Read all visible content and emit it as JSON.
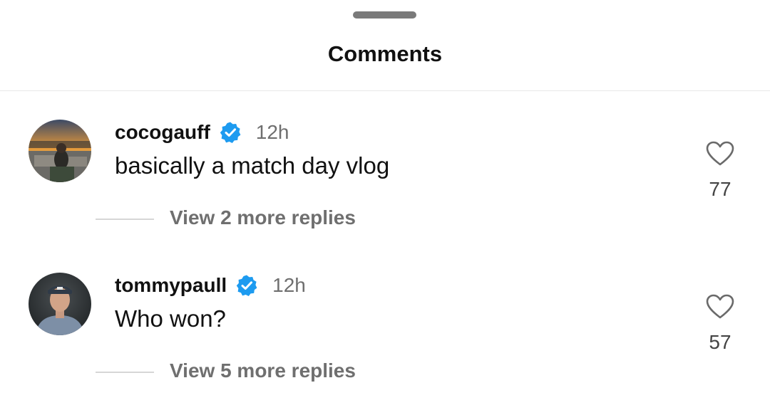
{
  "sheet": {
    "title": "Comments"
  },
  "comments": [
    {
      "username": "cocogauff",
      "verified": true,
      "time": "12h",
      "text": "basically a match day vlog",
      "likes": "77",
      "view_replies": "View 2 more replies"
    },
    {
      "username": "tommypaull",
      "verified": true,
      "time": "12h",
      "text": "Who won?",
      "likes": "57",
      "view_replies": "View 5 more replies"
    }
  ],
  "icons": {
    "verified": "verified-badge-icon",
    "like": "heart-icon"
  },
  "colors": {
    "verified_blue": "#1d9bf0",
    "muted_text": "#6f6f6f"
  }
}
